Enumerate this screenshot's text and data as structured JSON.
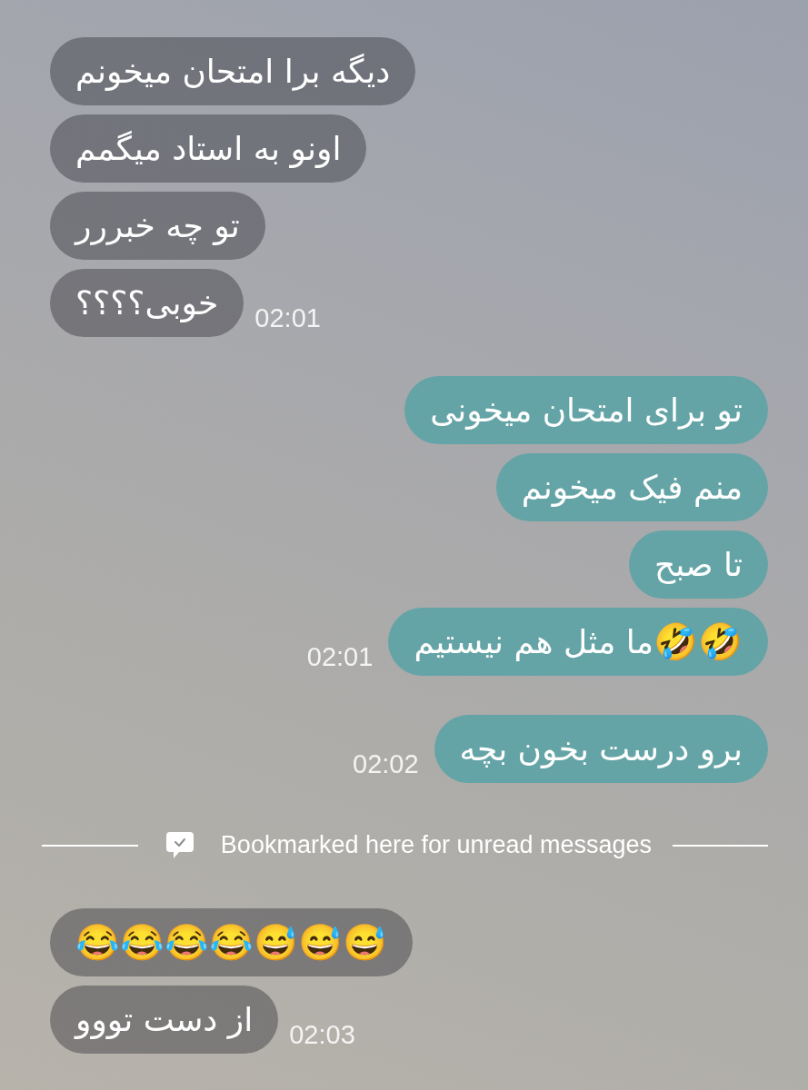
{
  "timeline": [
    {
      "kind": "message",
      "outgoing": false,
      "text": "دیگه برا امتحان میخونم"
    },
    {
      "kind": "message",
      "outgoing": false,
      "text": "اونو به استاد میگمم"
    },
    {
      "kind": "message",
      "outgoing": false,
      "text": "تو چه خبررر"
    },
    {
      "kind": "message",
      "outgoing": false,
      "text": "خوبی؟؟؟؟",
      "time": "02:01"
    },
    {
      "kind": "message",
      "outgoing": true,
      "text": "تو برای امتحان میخونی"
    },
    {
      "kind": "message",
      "outgoing": true,
      "text": "منم فیک میخونم"
    },
    {
      "kind": "message",
      "outgoing": true,
      "text": "تا صبح"
    },
    {
      "kind": "message",
      "outgoing": true,
      "text": "🤣🤣ما مثل هم نیستیم",
      "time": "02:01"
    },
    {
      "kind": "message",
      "outgoing": true,
      "text": "برو درست بخون بچه",
      "time": "02:02"
    },
    {
      "kind": "divider",
      "text": "Bookmarked here for unread messages"
    },
    {
      "kind": "message",
      "outgoing": false,
      "text": "😂😂😂😂😅😅😅"
    },
    {
      "kind": "message",
      "outgoing": false,
      "text": "از دست تووو",
      "time": "02:03"
    }
  ]
}
